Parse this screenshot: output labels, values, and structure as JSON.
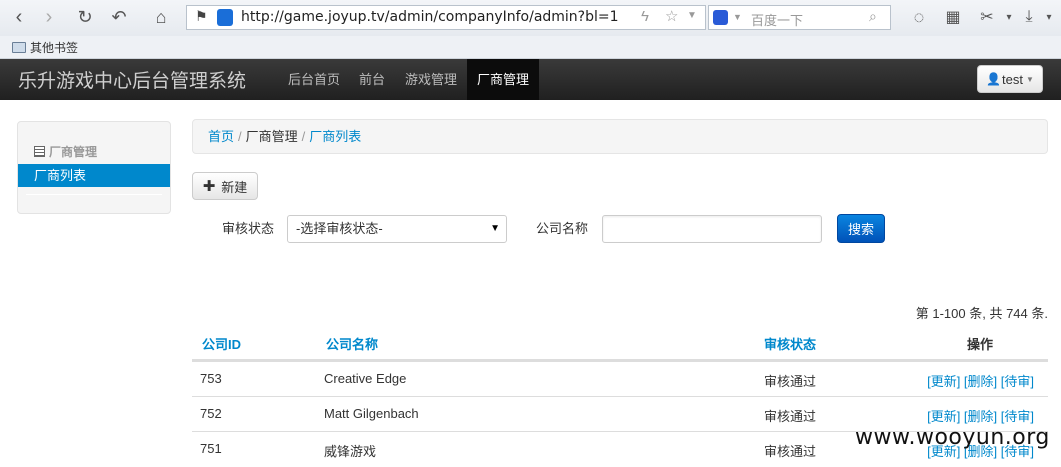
{
  "browser": {
    "url": "http://game.joyup.tv/admin/companyInfo/admin?bl=1",
    "search_placeholder": "百度一下",
    "bookmark_folder": "其他书签"
  },
  "navbar": {
    "brand": "乐升游戏中心后台管理系统",
    "items": [
      {
        "label": "后台首页"
      },
      {
        "label": "前台"
      },
      {
        "label": "游戏管理"
      },
      {
        "label": "厂商管理"
      }
    ],
    "user": "test"
  },
  "sidebar": {
    "header": "厂商管理",
    "item": "厂商列表"
  },
  "breadcrumb": {
    "home": "首页",
    "middle": "厂商管理",
    "current": "厂商列表",
    "sep": "/"
  },
  "toolbar": {
    "new_label": "新建"
  },
  "filters": {
    "status_label": "审核状态",
    "status_value": "-选择审核状态-",
    "name_label": "公司名称",
    "name_value": "",
    "search_label": "搜索"
  },
  "pager": {
    "info": "第 1-100 条, 共 744 条."
  },
  "table": {
    "headers": [
      "公司ID",
      "公司名称",
      "审核状态",
      "操作"
    ],
    "rows": [
      {
        "id": "753",
        "name": "Creative Edge",
        "status": "审核通过",
        "ops": "[更新] [删除] [待审]"
      },
      {
        "id": "752",
        "name": "Matt Gilgenbach",
        "status": "审核通过",
        "ops": "[更新] [删除] [待审]"
      },
      {
        "id": "751",
        "name": "威锋游戏",
        "status": "审核通过",
        "ops": "[更新] [删除] [待审]"
      }
    ]
  },
  "watermark": "www.wooyun.org",
  "colors": {
    "link": "#0088cc",
    "navbar": "#222222",
    "primary_button": "#0066cc"
  }
}
